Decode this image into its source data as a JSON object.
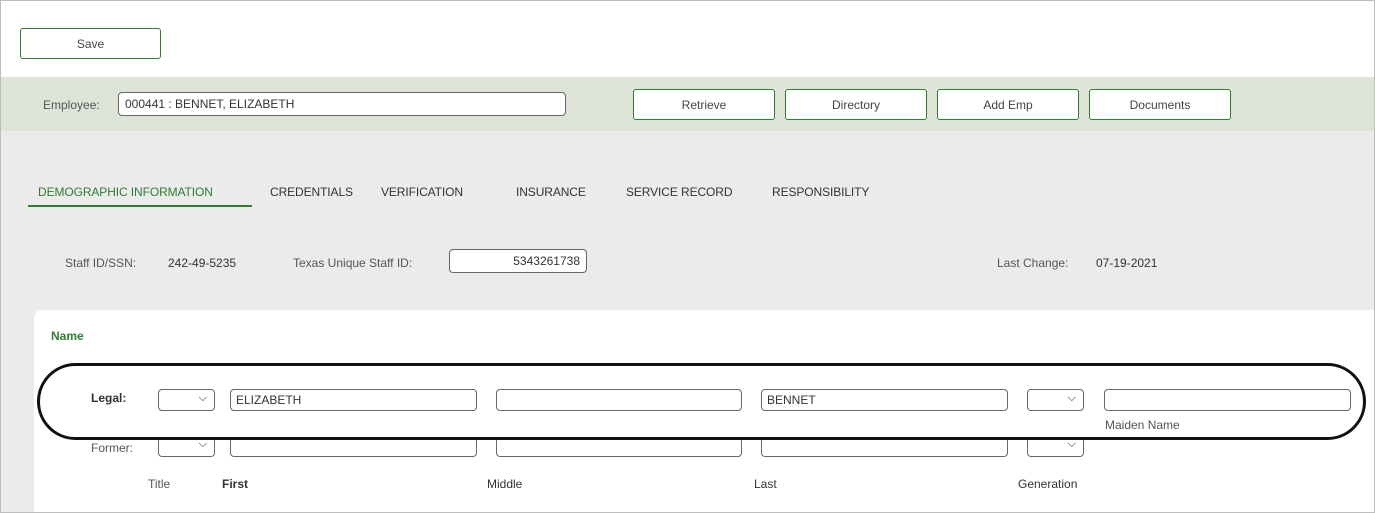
{
  "toolbar": {
    "save_label": "Save"
  },
  "employee": {
    "label": "Employee:",
    "value": "000441 : BENNET, ELIZABETH",
    "buttons": {
      "retrieve": "Retrieve",
      "directory": "Directory",
      "add_emp": "Add Emp",
      "documents": "Documents"
    }
  },
  "tabs": [
    {
      "label": "DEMOGRAPHIC INFORMATION",
      "active": true
    },
    {
      "label": "CREDENTIALS",
      "active": false
    },
    {
      "label": "VERIFICATION",
      "active": false
    },
    {
      "label": "INSURANCE",
      "active": false
    },
    {
      "label": "SERVICE RECORD",
      "active": false
    },
    {
      "label": "RESPONSIBILITY",
      "active": false
    }
  ],
  "info": {
    "staff_label": "Staff ID/SSN:",
    "staff_value": "242-49-5235",
    "tx_label": "Texas Unique Staff ID:",
    "tx_value": "5343261738",
    "last_change_label": "Last Change:",
    "last_change_value": "07-19-2021"
  },
  "name": {
    "title": "Name",
    "legal": {
      "label": "Legal:",
      "title": "",
      "first": "ELIZABETH",
      "middle": "",
      "last": "BENNET",
      "generation": "",
      "maiden": ""
    },
    "former": {
      "label": "Former:",
      "title": "",
      "first": "",
      "middle": "",
      "last": "",
      "generation": ""
    },
    "columns": {
      "title": "Title",
      "first": "First",
      "middle": "Middle",
      "last": "Last",
      "generation": "Generation"
    },
    "maiden_label": "Maiden Name"
  },
  "icons": {
    "dropdown": "chevron-down-icon"
  },
  "colors": {
    "accent": "#2e7d32",
    "employee_bar": "#dde3d6",
    "main_bg": "#ebebeb",
    "highlight": "#111111"
  }
}
